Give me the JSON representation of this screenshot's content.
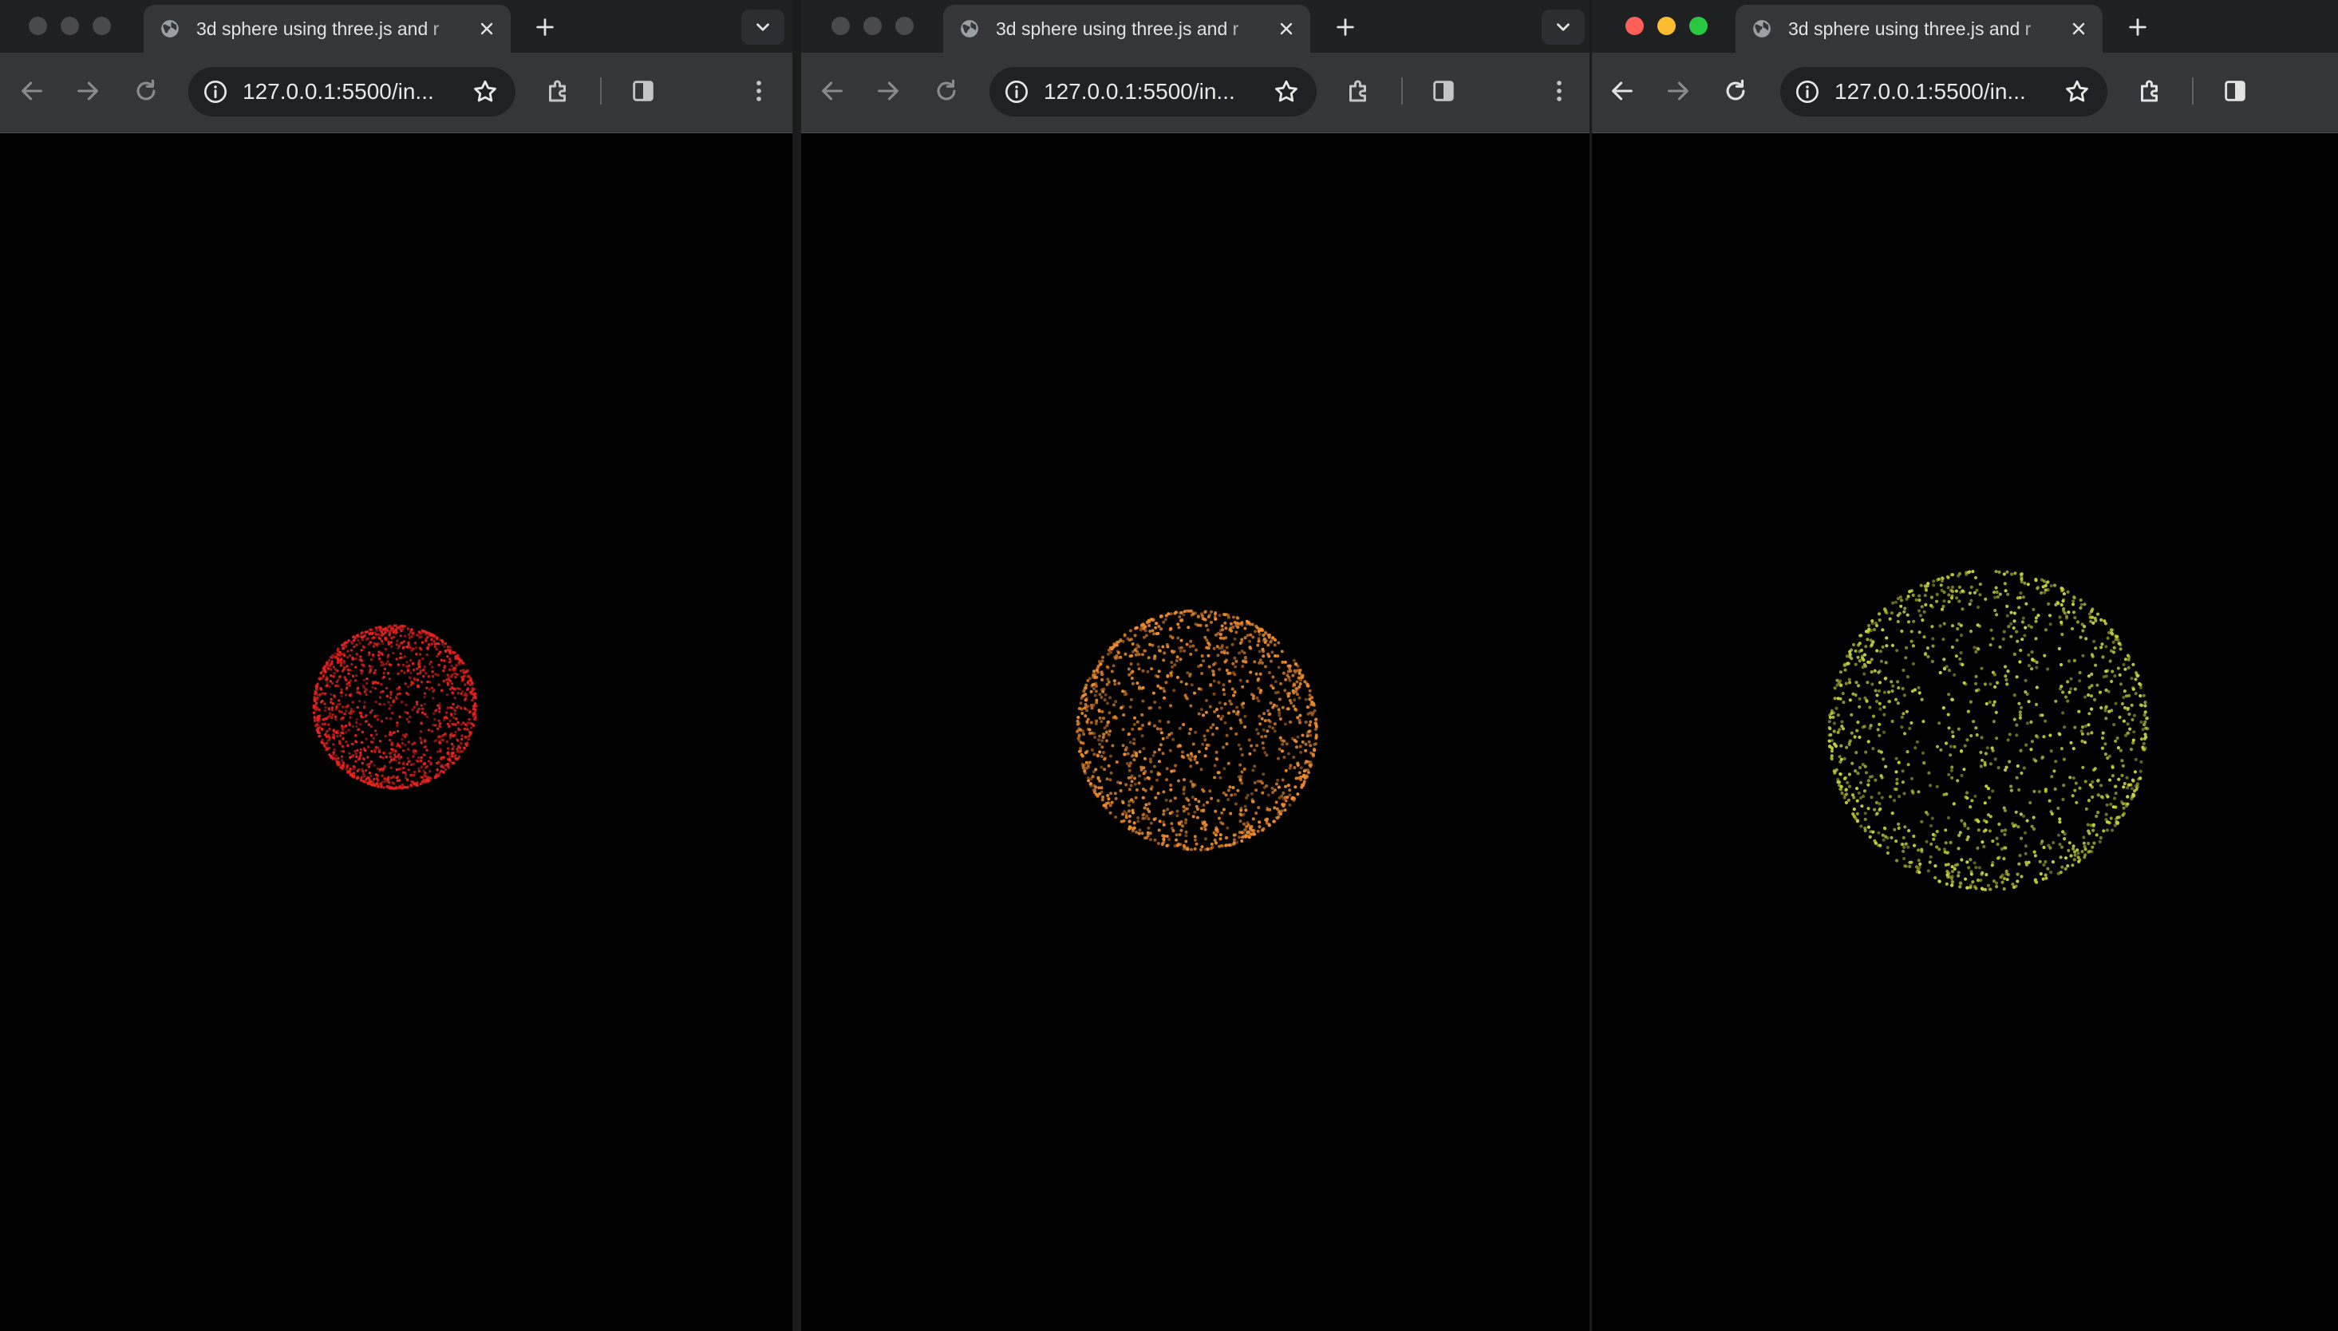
{
  "windows": [
    {
      "id": "left",
      "tab_title": "3d sphere using three.js and r",
      "url": "127.0.0.1:5500/in...",
      "focused": false,
      "sphere_color": "#e8231f",
      "sphere_color_name": "red"
    },
    {
      "id": "middle",
      "tab_title": "3d sphere using three.js and r",
      "url": "127.0.0.1:5500/in...",
      "focused": false,
      "sphere_color": "#ef8d2e",
      "sphere_color_name": "orange"
    },
    {
      "id": "right",
      "tab_title": "3d sphere using three.js and r",
      "url": "127.0.0.1:5500/in...",
      "focused": true,
      "sphere_color": "#c8d43c",
      "sphere_color_name": "yellow-green"
    }
  ],
  "icons": {
    "tab_favicon": "globe-icon",
    "close": "close-icon",
    "new_tab": "plus-icon",
    "tab_search": "chevron-down-icon",
    "back": "back-arrow-icon",
    "forward": "forward-arrow-icon",
    "reload": "reload-icon",
    "site_info": "info-icon",
    "bookmark": "star-icon",
    "extensions": "puzzle-icon",
    "side_panel": "side-panel-icon",
    "menu": "kebab-menu-icon"
  },
  "colors": {
    "tabstrip": "#1f2022",
    "toolbar": "#35363a",
    "omnibox": "#202124",
    "canvas": "#000000"
  }
}
